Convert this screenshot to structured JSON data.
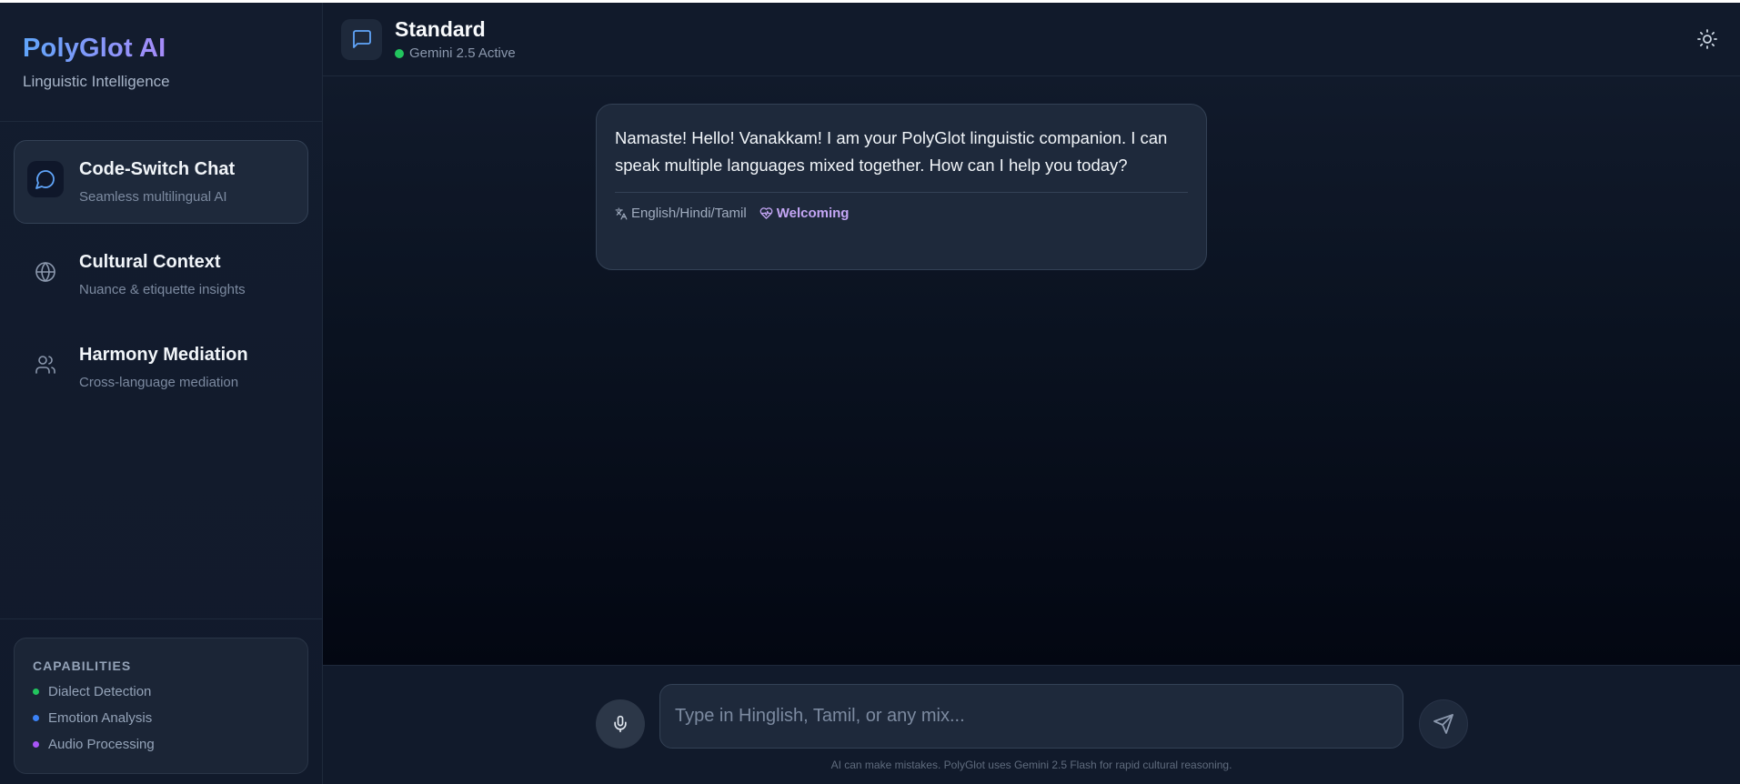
{
  "brand": {
    "title": "PolyGlot AI",
    "subtitle": "Linguistic Intelligence"
  },
  "nav": {
    "items": [
      {
        "title": "Code-Switch Chat",
        "desc": "Seamless multilingual AI",
        "icon": "chat-bubble-icon",
        "active": true
      },
      {
        "title": "Cultural Context",
        "desc": "Nuance & etiquette insights",
        "icon": "globe-icon",
        "active": false
      },
      {
        "title": "Harmony Mediation",
        "desc": "Cross-language mediation",
        "icon": "users-icon",
        "active": false
      }
    ]
  },
  "capabilities": {
    "title": "CAPABILITIES",
    "items": [
      {
        "label": "Dialect Detection",
        "color": "#22c55e"
      },
      {
        "label": "Emotion Analysis",
        "color": "#3b82f6"
      },
      {
        "label": "Audio Processing",
        "color": "#a855f7"
      }
    ]
  },
  "header": {
    "title": "Standard",
    "status": "Gemini 2.5 Active",
    "status_color": "#22c55e"
  },
  "messages": [
    {
      "text": "Namaste! Hello! Vanakkam! I am your PolyGlot linguistic companion. I can speak multiple languages mixed together. How can I help you today?",
      "languages": "English/Hindi/Tamil",
      "emotion": "Welcoming"
    }
  ],
  "composer": {
    "placeholder": "Type in Hinglish, Tamil, or any mix...",
    "value": "",
    "disclaimer": "AI can make mistakes. PolyGlot uses Gemini 2.5 Flash for rapid cultural reasoning."
  },
  "colors": {
    "accent_blue": "#60a5fa",
    "accent_purple": "#a78bfa",
    "background": "#0f172a"
  }
}
